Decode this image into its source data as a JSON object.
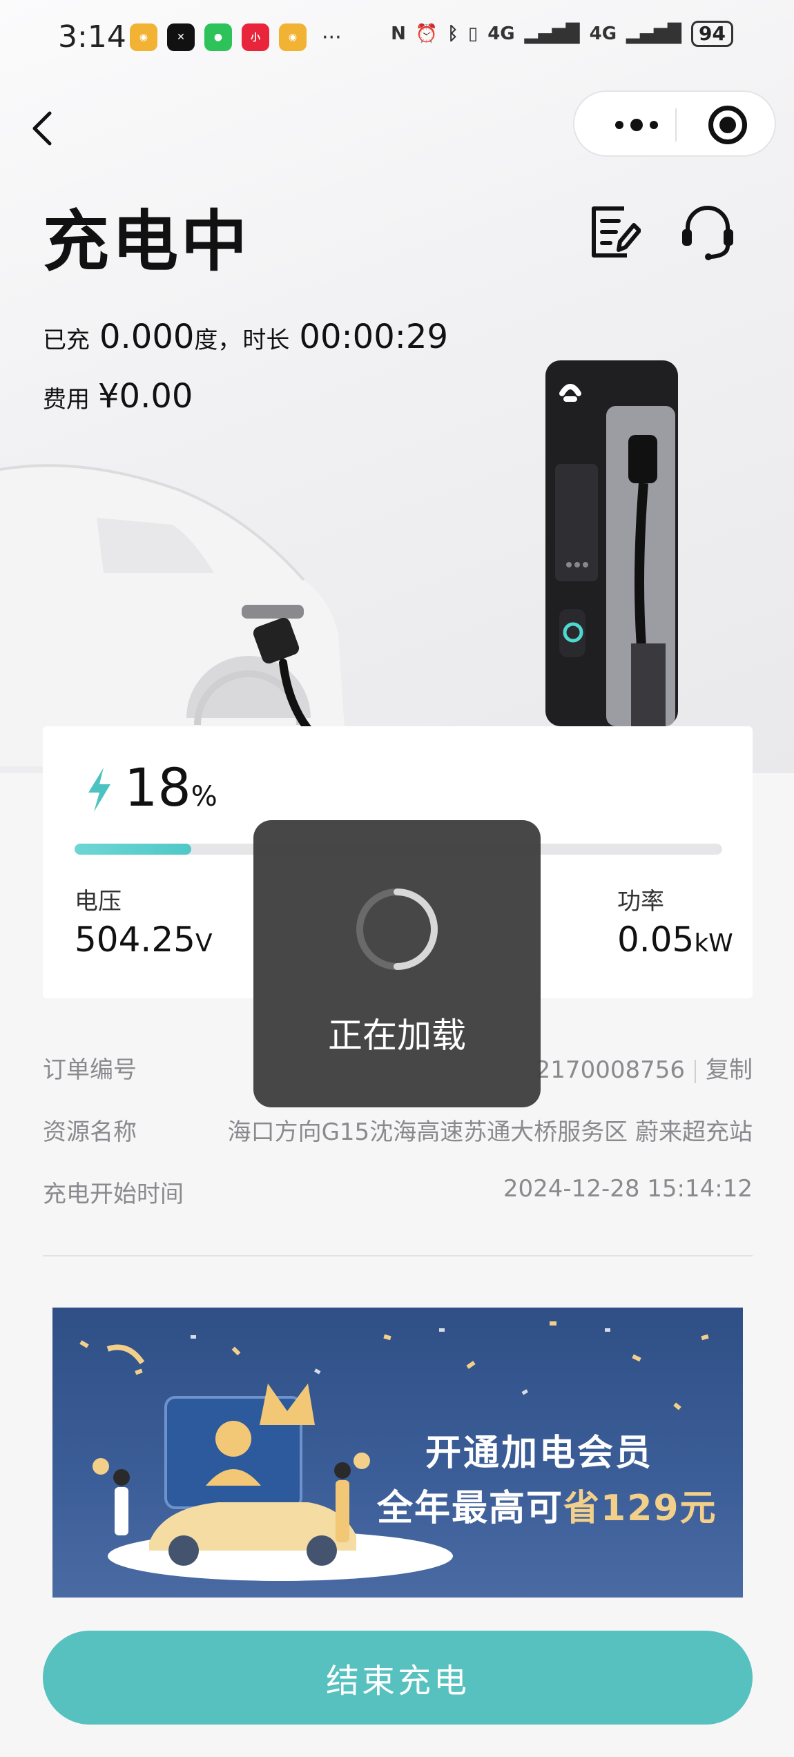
{
  "status_bar": {
    "time": "3:14",
    "dots": "···",
    "signal1": "4G",
    "signal2": "4G",
    "battery": "94"
  },
  "header": {
    "title": "充电中"
  },
  "session": {
    "charged_label": "已充",
    "charged_value": "0.000",
    "charged_unit": "度，",
    "duration_label": "时长",
    "duration_value": "00:00:29",
    "cost_label": "费用",
    "cost_value": "¥0.00"
  },
  "charge_card": {
    "percent": "18",
    "percent_unit": "%",
    "progress": 0.18,
    "voltage_label": "电压",
    "voltage_value": "504.25",
    "voltage_unit": "V",
    "power_label": "功率",
    "power_value": "0.05",
    "power_unit": "kW"
  },
  "loading": {
    "text": "正在加载"
  },
  "info": {
    "order_label": "订单编号",
    "order_value": "2170008756",
    "copy_label": "复制",
    "resource_label": "资源名称",
    "resource_value": "海口方向G15沈海高速苏通大桥服务区 蔚来超充站",
    "start_label": "充电开始时间",
    "start_value": "2024-12-28 15:14:12"
  },
  "banner": {
    "line1": "开通加电会员",
    "line2_prefix": "全年最高可",
    "line2_highlight": "省129元"
  },
  "footer": {
    "end_button": "结束充电"
  },
  "colors": {
    "accent": "#56c1bf",
    "progress": "#5fcfcd",
    "banner_bg": "#34558e",
    "highlight": "#f3d08a"
  }
}
